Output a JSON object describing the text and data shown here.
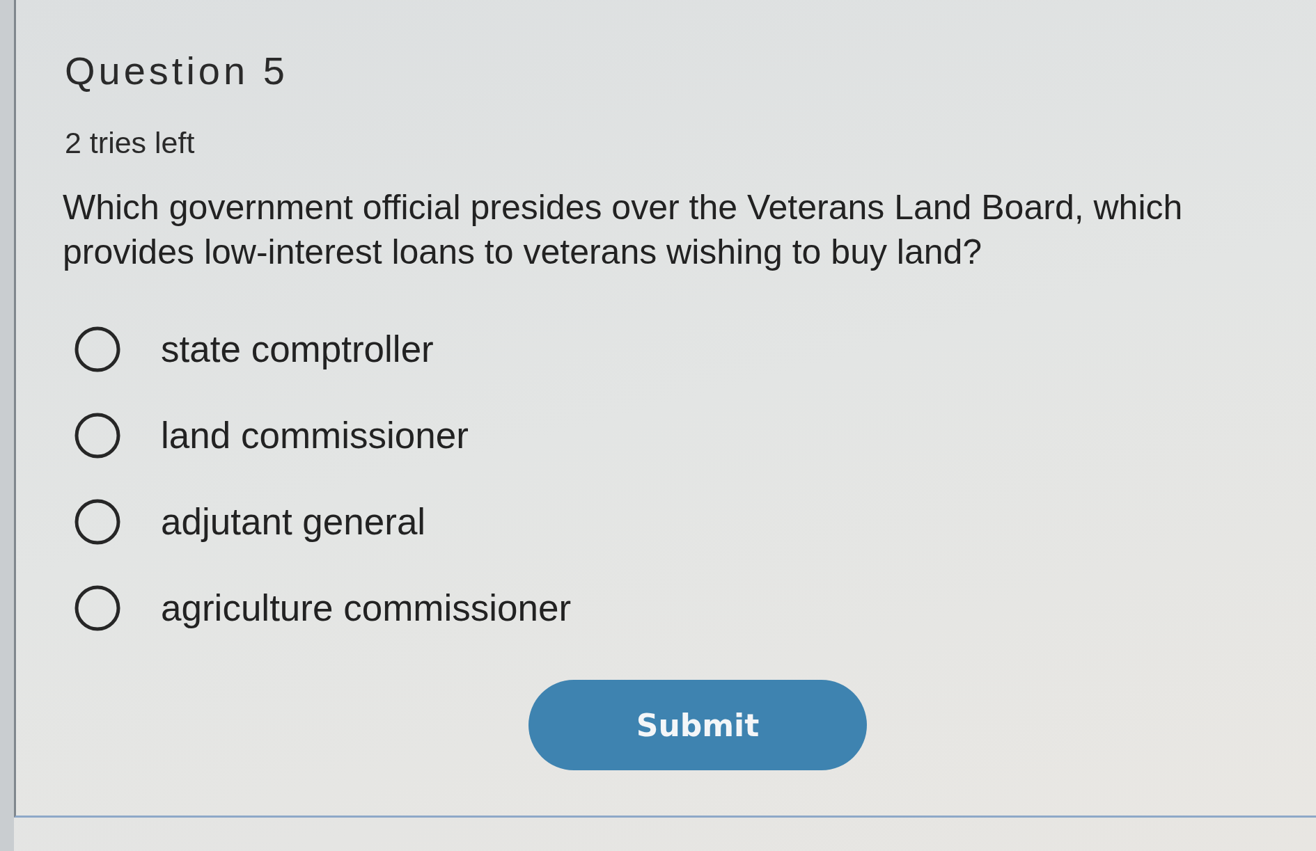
{
  "question": {
    "title": "Question 5",
    "tries_left": "2 tries left",
    "prompt": "Which government official presides over the Veterans Land Board, which provides low-interest loans to veterans wishing to buy land?"
  },
  "options": [
    {
      "label": "state comptroller",
      "selected": false
    },
    {
      "label": "land commissioner",
      "selected": false
    },
    {
      "label": "adjutant general",
      "selected": false
    },
    {
      "label": "agriculture commissioner",
      "selected": false
    }
  ],
  "submit_button": {
    "label": "Submit"
  }
}
